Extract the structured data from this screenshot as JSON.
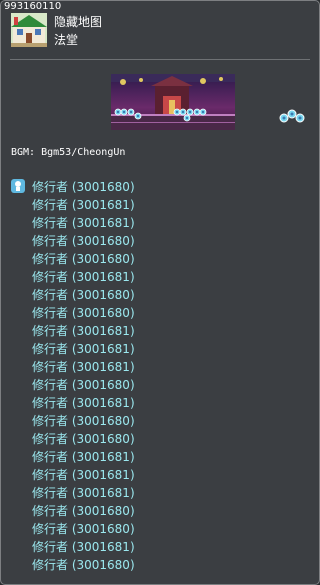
{
  "map": {
    "id": "993160110",
    "region": "隐藏地图",
    "name": "法堂",
    "bgm": "BGM: Bgm53/CheongUn"
  },
  "icons": {
    "map_icon": "village-building-icon",
    "portal": "portal-icon",
    "npc": "npc-marker-icon"
  },
  "colors": {
    "panel_bg": "#3b3e42",
    "mob_text": "#9be8ef",
    "npc_marker": "#5fb8e0"
  },
  "mobs": [
    "修行者 (3001680)",
    "修行者 (3001681)",
    "修行者 (3001681)",
    "修行者 (3001680)",
    "修行者 (3001680)",
    "修行者 (3001681)",
    "修行者 (3001680)",
    "修行者 (3001680)",
    "修行者 (3001681)",
    "修行者 (3001681)",
    "修行者 (3001681)",
    "修行者 (3001680)",
    "修行者 (3001681)",
    "修行者 (3001680)",
    "修行者 (3001680)",
    "修行者 (3001681)",
    "修行者 (3001681)",
    "修行者 (3001681)",
    "修行者 (3001680)",
    "修行者 (3001680)",
    "修行者 (3001681)",
    "修行者 (3001680)"
  ]
}
